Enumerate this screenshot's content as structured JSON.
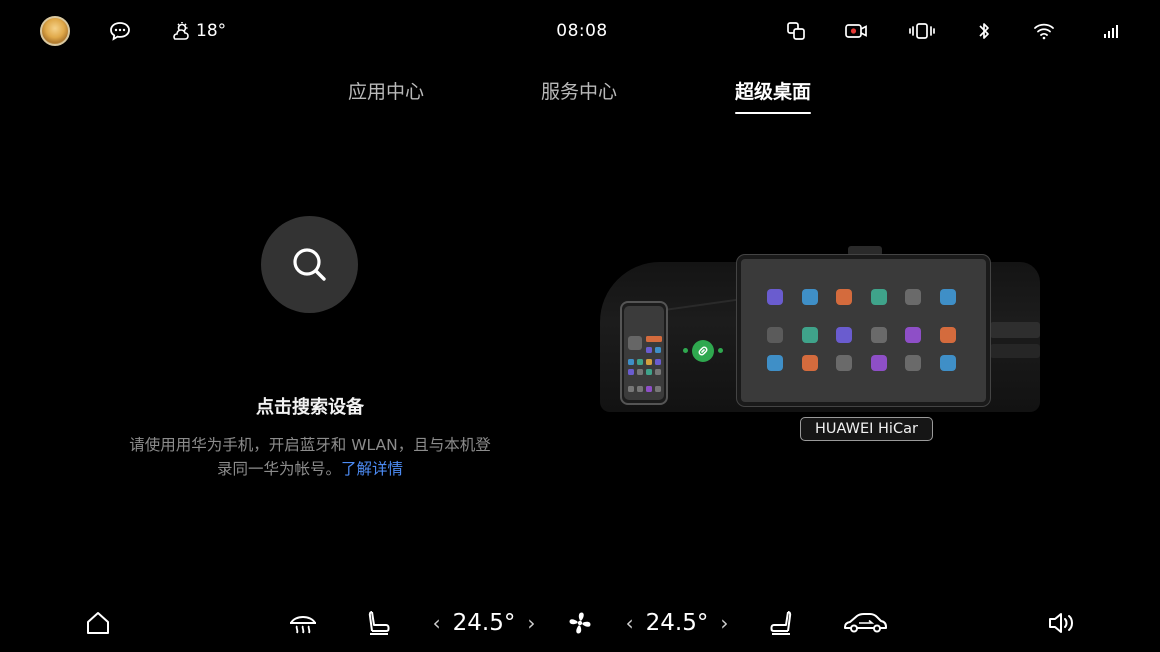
{
  "status_bar": {
    "weather_temp": "18°",
    "time": "08:08",
    "icons": [
      "avatar",
      "message-icon",
      "weather-cloud-sun-icon",
      "screen-share-icon",
      "dashcam-icon",
      "vibrate-icon",
      "bluetooth-icon",
      "wifi-icon",
      "signal-icon"
    ]
  },
  "tabs": [
    {
      "label": "应用中心",
      "active": false
    },
    {
      "label": "服务中心",
      "active": false
    },
    {
      "label": "超级桌面",
      "active": true
    }
  ],
  "main": {
    "title": "点击搜索设备",
    "description_line1": "请使用用华为手机，开启蓝牙和 WLAN，且与本机登",
    "description_line2_prefix": "录同一华为帐号。",
    "learn_more_link": "了解详情",
    "hicar_label": "HUAWEI HiCar"
  },
  "climate": {
    "left_temp": "24.5°",
    "right_temp": "24.5°"
  },
  "colors": {
    "background": "#000000",
    "link": "#4d8cf5",
    "connect_green": "#2fa84f",
    "search_circle": "#333333"
  }
}
